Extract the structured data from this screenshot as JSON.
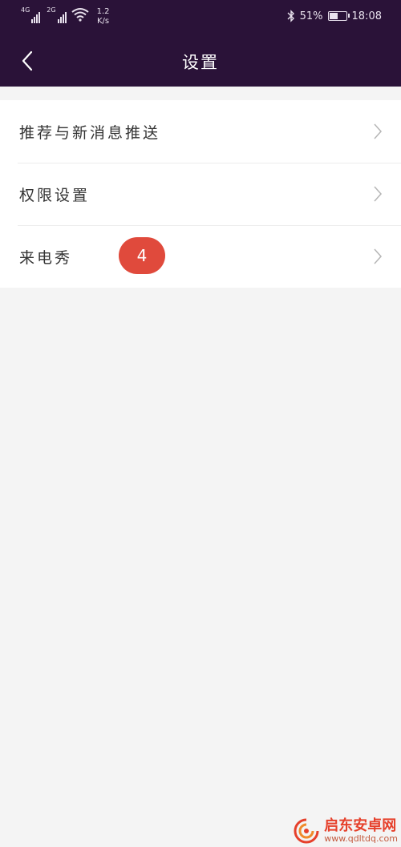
{
  "statusbar": {
    "net1_label": "4G",
    "net2_label": "2G",
    "speed_value": "1.2",
    "speed_unit": "K/s",
    "battery": "51%",
    "time": "18:08",
    "battery_level": 0.51
  },
  "navbar": {
    "title": "设置",
    "back_icon": "chevron-left-icon"
  },
  "settings": {
    "items": [
      {
        "label": "推荐与新消息推送"
      },
      {
        "label": "权限设置"
      },
      {
        "label": "来电秀"
      }
    ]
  },
  "badge": {
    "text": "4"
  },
  "watermark": {
    "name": "启东安卓网",
    "url": "www.qdltdq.com"
  },
  "colors": {
    "header_bg": "#2a1238",
    "page_bg": "#f4f4f4",
    "badge_bg": "#e04a3c",
    "watermark": "#e6402b"
  }
}
